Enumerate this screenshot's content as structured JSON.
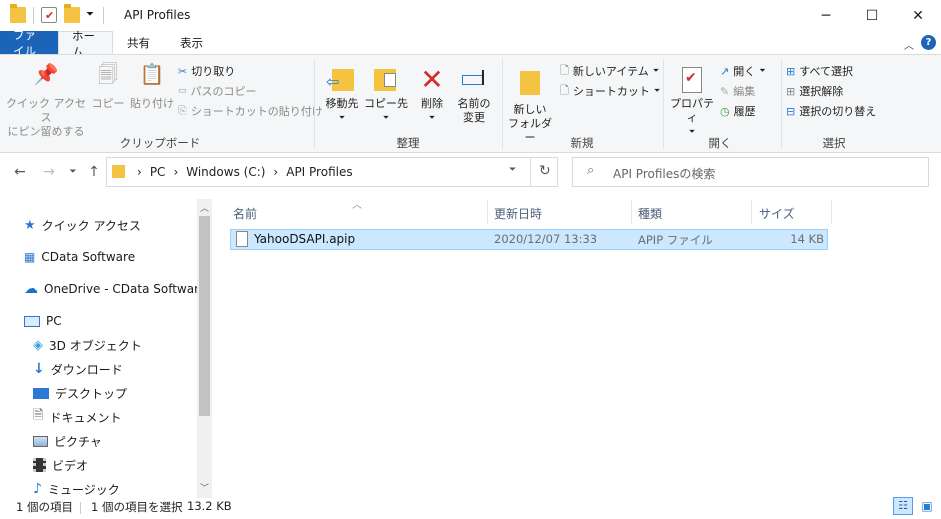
{
  "window": {
    "title": "API Profiles",
    "controls": [
      "─",
      "☐",
      "✕"
    ]
  },
  "ribbon_tabs": [
    "ファイル",
    "ホーム",
    "共有",
    "表示"
  ],
  "ribbon": {
    "clipboard": {
      "pin": "クイック アクセス\nにピン留めする",
      "copy": "コピー",
      "paste": "貼り付け",
      "cut": "切り取り",
      "copy_path": "パスのコピー",
      "paste_shortcut": "ショートカットの貼り付け",
      "label": "クリップボード"
    },
    "organize": {
      "move_to": "移動先",
      "copy_to": "コピー先",
      "delete": "削除",
      "rename": "名前の\n変更",
      "label": "整理"
    },
    "new": {
      "new_folder": "新しい\nフォルダー",
      "new_item": "新しいアイテム",
      "easy_access": "ショートカット",
      "label": "新規"
    },
    "open": {
      "properties": "プロパティ",
      "open": "開く",
      "edit": "編集",
      "history": "履歴",
      "label": "開く"
    },
    "select": {
      "select_all": "すべて選択",
      "select_none": "選択解除",
      "invert": "選択の切り替え",
      "label": "選択"
    }
  },
  "address": {
    "crumbs": [
      "PC",
      "Windows (C:)",
      "API Profiles"
    ],
    "search_placeholder": "API Profilesの検索"
  },
  "sidebar": {
    "items": [
      {
        "label": "クイック アクセス",
        "icon": "star-icon"
      },
      {
        "label": "CData Software",
        "icon": "building-icon"
      },
      {
        "label": "OneDrive - CData Software",
        "icon": "cloud-icon"
      },
      {
        "label": "PC",
        "icon": "pc-icon"
      },
      {
        "label": "3D オブジェクト",
        "icon": "cube-icon"
      },
      {
        "label": "ダウンロード",
        "icon": "download-icon"
      },
      {
        "label": "デスクトップ",
        "icon": "desktop-icon"
      },
      {
        "label": "ドキュメント",
        "icon": "document-icon"
      },
      {
        "label": "ピクチャ",
        "icon": "picture-icon"
      },
      {
        "label": "ビデオ",
        "icon": "video-icon"
      },
      {
        "label": "ミュージック",
        "icon": "music-icon"
      }
    ]
  },
  "columns": [
    "名前",
    "更新日時",
    "種類",
    "サイズ"
  ],
  "files": [
    {
      "name": "YahooDSAPI.apip",
      "modified": "2020/12/07 13:33",
      "type": "APIP ファイル",
      "size": "14 KB"
    }
  ],
  "status": {
    "count": "1 個の項目",
    "selected": "1 個の項目を選択",
    "size": "13.2 KB"
  },
  "colors": {
    "file_tab": "#1b64b8",
    "selection": "#cce8ff",
    "selection_border": "#99d1ff"
  }
}
